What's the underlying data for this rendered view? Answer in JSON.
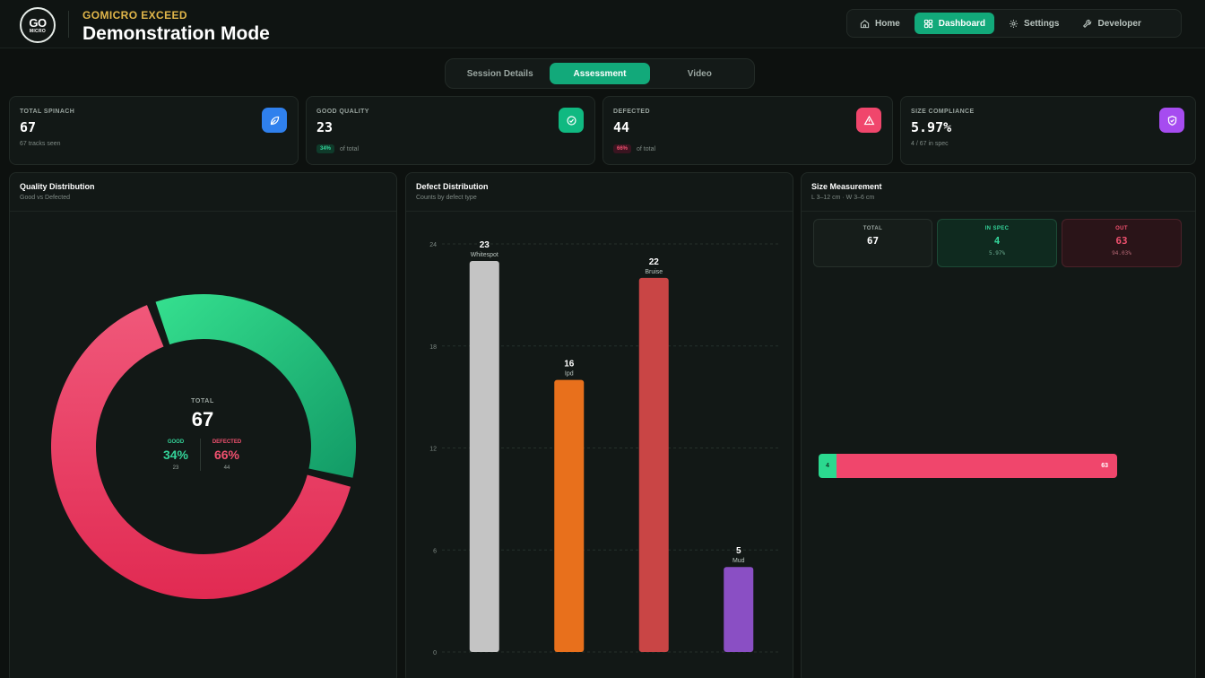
{
  "header": {
    "logo_top": "GO",
    "logo_bottom": "MICRO",
    "brand": "GOMICRO EXCEED",
    "title": "Demonstration Mode",
    "nav": [
      {
        "label": "Home",
        "icon": "home-icon",
        "active": false
      },
      {
        "label": "Dashboard",
        "icon": "grid-icon",
        "active": true
      },
      {
        "label": "Settings",
        "icon": "gear-icon",
        "active": false
      },
      {
        "label": "Developer",
        "icon": "wrench-icon",
        "active": false
      }
    ]
  },
  "tabs": [
    {
      "label": "Session Details",
      "active": false
    },
    {
      "label": "Assessment",
      "active": true
    },
    {
      "label": "Video",
      "active": false
    }
  ],
  "stats": [
    {
      "label": "TOTAL SPINACH",
      "value": "67",
      "sub": "67 tracks seen",
      "icon": "leaf-icon",
      "color": "#2f80ed"
    },
    {
      "label": "GOOD QUALITY",
      "value": "23",
      "pill": "34%",
      "sub": "of total",
      "icon": "check-circle-icon",
      "color": "#10b981"
    },
    {
      "label": "DEFECTED",
      "value": "44",
      "pill": "66%",
      "sub": "of total",
      "icon": "warning-icon",
      "color": "#f0466c"
    },
    {
      "label": "SIZE COMPLIANCE",
      "value": "5.97%",
      "sub": "4 / 67 in spec",
      "icon": "shield-check-icon",
      "color": "#a64cf0"
    }
  ],
  "quality": {
    "title": "Quality Distribution",
    "subtitle": "Good vs Defected",
    "total_label": "TOTAL",
    "total": "67",
    "good_label": "GOOD",
    "good_pct": "34%",
    "good_count": "23",
    "defected_label": "DEFECTED",
    "defected_pct": "66%",
    "defected_count": "44",
    "good_color": "#22c77f",
    "defected_color": "#ec3d60"
  },
  "defects": {
    "title": "Defect Distribution",
    "subtitle": "Counts by defect type"
  },
  "size": {
    "title": "Size Measurement",
    "subtitle": "L 3–12 cm · W 3–6 cm",
    "total_label": "TOTAL",
    "total": "67",
    "in_label": "IN SPEC",
    "in_value": "4",
    "in_pct": "5.97%",
    "out_label": "OUT",
    "out_value": "63",
    "out_pct": "94.03%",
    "bar_in_label": "4",
    "bar_out_label": "63"
  },
  "chart_data": [
    {
      "type": "pie",
      "categories": [
        "Good",
        "Defected"
      ],
      "values": [
        23,
        44
      ]
    },
    {
      "type": "bar",
      "categories": [
        "Whitespot",
        "Ipd",
        "Bruise",
        "Mud"
      ],
      "values": [
        23,
        16,
        22,
        5
      ],
      "colors": [
        "#c4c4c4",
        "#e8701c",
        "#c94545",
        "#8a4fc4"
      ],
      "yticks": [
        0,
        6,
        12,
        18,
        24
      ],
      "ylim": [
        0,
        24
      ],
      "grid": true
    },
    {
      "type": "bar",
      "orientation": "horizontal",
      "stacked": true,
      "categories": [
        "In spec",
        "Out"
      ],
      "values": [
        4,
        63
      ],
      "colors": [
        "#2bd98f",
        "#f0466c"
      ]
    }
  ]
}
